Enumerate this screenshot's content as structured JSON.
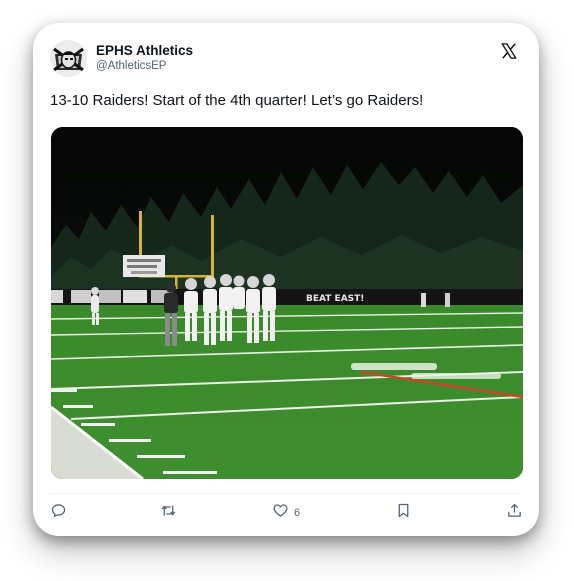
{
  "account": {
    "display_name": "EPHS Athletics",
    "handle": "@AthleticsEP"
  },
  "tweet": {
    "text": "13-10 Raiders! Start of the 4th quarter! Let’s go Raiders!"
  },
  "media": {
    "banner_text": "BEAT EAST!"
  },
  "actions": {
    "like_count": "6"
  },
  "icons": {
    "brand": "x-logo-icon",
    "reply": "reply-icon",
    "retweet": "retweet-icon",
    "like": "heart-icon",
    "bookmark": "bookmark-icon",
    "share": "share-icon"
  },
  "colors": {
    "text": "#0f1419",
    "muted": "#536471",
    "field": "#3f8a2e"
  }
}
